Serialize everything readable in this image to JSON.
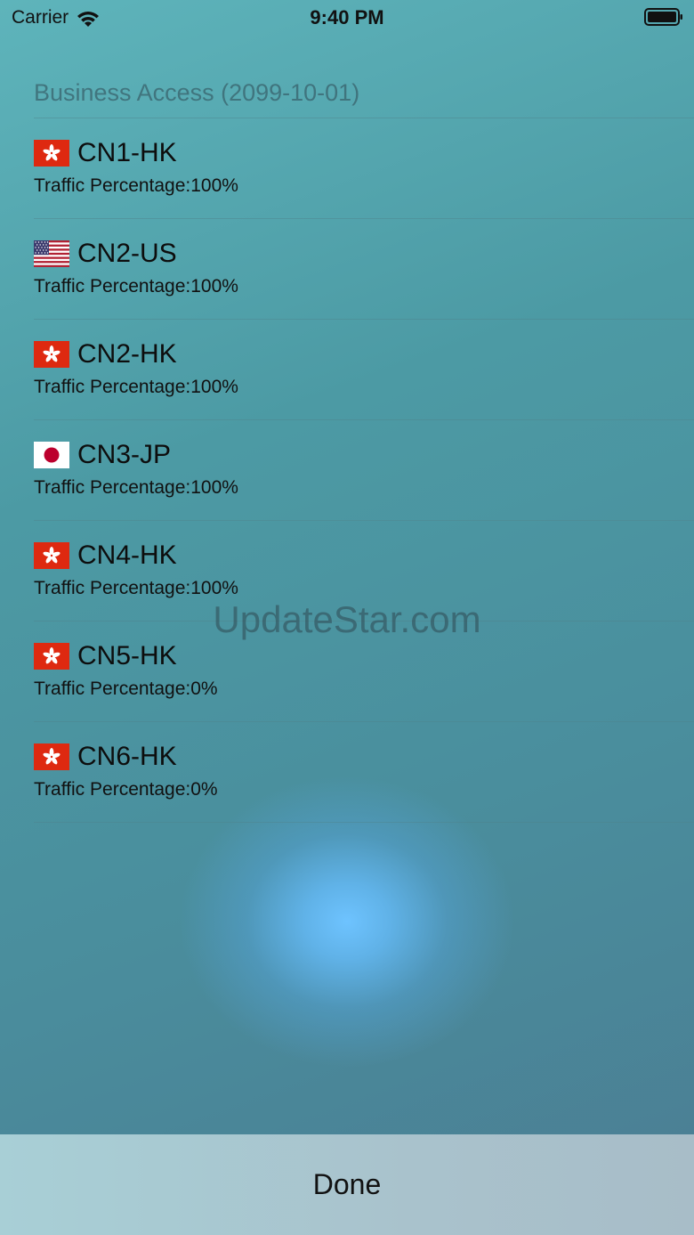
{
  "status_bar": {
    "carrier": "Carrier",
    "time": "9:40 PM",
    "wifi_icon": "wifi-icon",
    "battery_icon": "battery-icon"
  },
  "section": {
    "title": "Business Access (2099-10-01)"
  },
  "servers": [
    {
      "name": "CN1-HK",
      "flag": "hk",
      "traffic": "Traffic Percentage:100%"
    },
    {
      "name": "CN2-US",
      "flag": "us",
      "traffic": "Traffic Percentage:100%"
    },
    {
      "name": "CN2-HK",
      "flag": "hk",
      "traffic": "Traffic Percentage:100%"
    },
    {
      "name": "CN3-JP",
      "flag": "jp",
      "traffic": "Traffic Percentage:100%"
    },
    {
      "name": "CN4-HK",
      "flag": "hk",
      "traffic": "Traffic Percentage:100%"
    },
    {
      "name": "CN5-HK",
      "flag": "hk",
      "traffic": "Traffic Percentage:0%"
    },
    {
      "name": "CN6-HK",
      "flag": "hk",
      "traffic": "Traffic Percentage:0%"
    }
  ],
  "watermark": "UpdateStar.com",
  "footer": {
    "done_label": "Done"
  },
  "colors": {
    "hk_red": "#de2910",
    "us_red": "#b22234",
    "us_blue": "#3c3b6e",
    "jp_red": "#bc002d"
  }
}
